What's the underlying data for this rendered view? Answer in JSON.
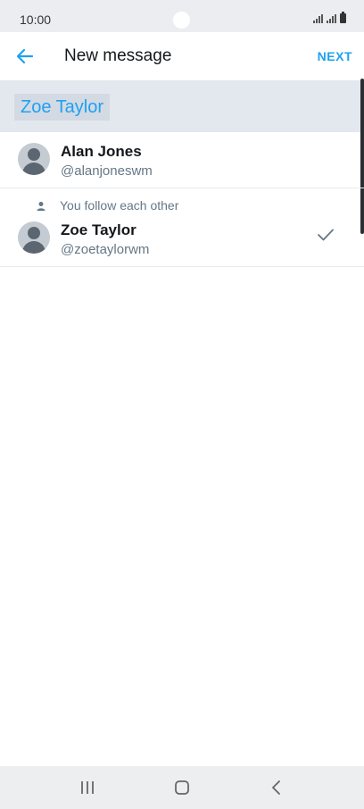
{
  "status_bar": {
    "time": "10:00"
  },
  "header": {
    "title": "New message",
    "next_label": "NEXT"
  },
  "recipients": [
    "Zoe Taylor"
  ],
  "contacts": [
    {
      "name": "Alan Jones",
      "handle": "@alanjoneswm",
      "note": "",
      "selected": false
    },
    {
      "name": "Zoe Taylor",
      "handle": "@zoetaylorwm",
      "note": "You follow each other",
      "selected": true
    }
  ],
  "colors": {
    "accent": "#1da1f2",
    "recipient_bar": "#e3e8ef",
    "muted_text": "#657786"
  },
  "icons": [
    "back-arrow-icon",
    "person-icon",
    "checkmark-icon",
    "recent-apps-icon",
    "home-icon",
    "back-icon"
  ]
}
